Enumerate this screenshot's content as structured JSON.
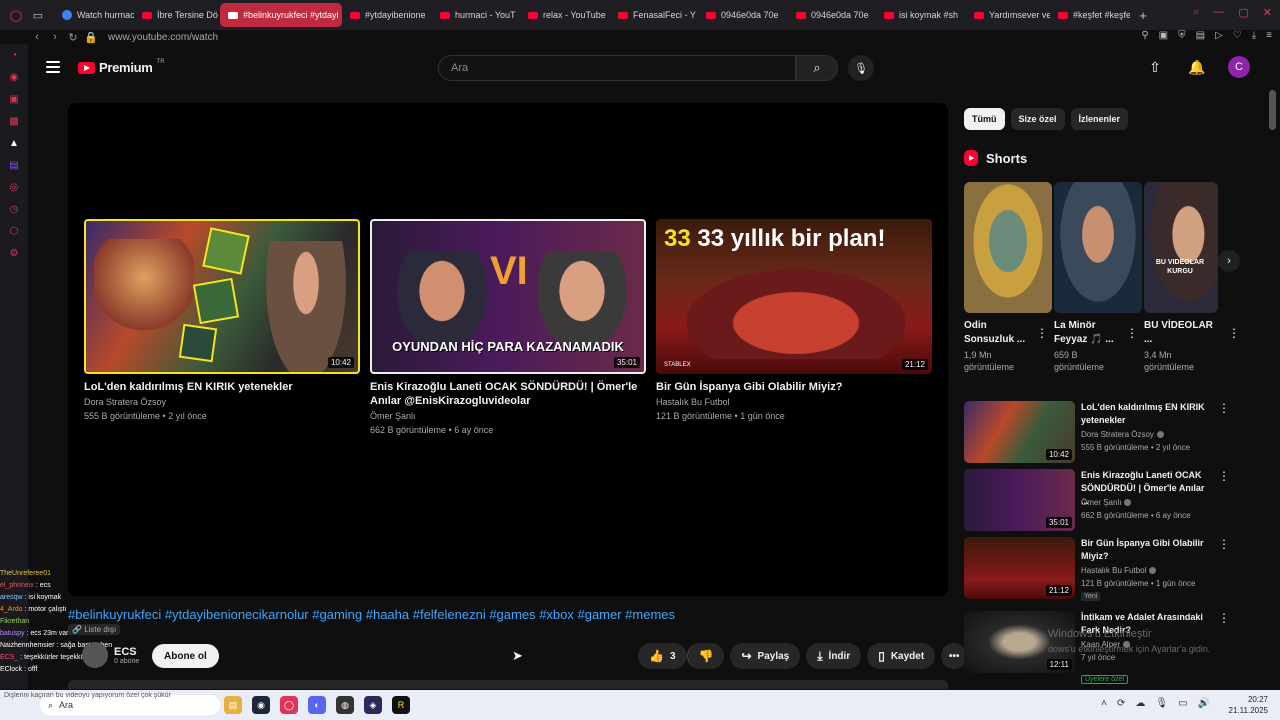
{
  "browser": {
    "tabs": [
      {
        "label": "",
        "active": false,
        "icon": "grid-icon"
      },
      {
        "label": "Watch hurmac",
        "active": false,
        "icon": "globe-icon"
      },
      {
        "label": "İbre Tersine Dö",
        "active": false,
        "icon": "youtube-icon"
      },
      {
        "label": "#belinkuyrukfeci #ytdayi",
        "active": true,
        "icon": "youtube-icon"
      },
      {
        "label": "#ytdayibenione",
        "active": false,
        "icon": "youtube-icon"
      },
      {
        "label": "hurmaci - YouT",
        "active": false,
        "icon": "youtube-icon"
      },
      {
        "label": "relax - YouTube",
        "active": false,
        "icon": "youtube-icon"
      },
      {
        "label": "FenasalFeci - Y",
        "active": false,
        "icon": "youtube-icon"
      },
      {
        "label": "0946e0da 70e",
        "active": false,
        "icon": "youtube-icon"
      },
      {
        "label": "0946e0da 70e",
        "active": false,
        "icon": "youtube-icon"
      },
      {
        "label": "isi koymak #sh",
        "active": false,
        "icon": "youtube-icon"
      },
      {
        "label": "Yardımsever ve",
        "active": false,
        "icon": "youtube-icon"
      },
      {
        "label": "#keşfet #keşfet",
        "active": false,
        "icon": "youtube-icon"
      }
    ],
    "url": "www.youtube.com/watch"
  },
  "header": {
    "logo_text": "Premium",
    "logo_region": "TR",
    "search_placeholder": "Ara",
    "avatar_letter": "C"
  },
  "endcards": [
    {
      "title": "LoL'den kaldırılmış EN KIRIK yetenekler",
      "channel": "Dora Stratera Özsoy",
      "meta": "555 B görüntüleme • 2 yıl önce",
      "duration": "10:42"
    },
    {
      "title": "Enis Kirazoğlu Laneti OCAK SÖNDÜRDÜ! | Ömer'le Anılar @EnisKirazogluvideolar",
      "channel": "Ömer Şanlı",
      "meta": "662 B görüntüleme • 6 ay önce",
      "duration": "35:01",
      "thumb_text": "OYUNDAN HİÇ PARA KAZANAMADIK"
    },
    {
      "title": "Bir Gün İspanya Gibi Olabilir Miyiz?",
      "channel": "Hastalık Bu Futbol",
      "meta": "121 B görüntüleme • 1 gün önce",
      "duration": "21:12",
      "thumb_text": "33 yıllık bir plan!",
      "thumb_badge": "STABLEX"
    }
  ],
  "video": {
    "hashtags": "#belinkuyrukfeci #ytdayibenionecikarnolur #gaming #haaha #felfelenezni #games #xbox #gamer #memes",
    "visibility": "Liste dışı",
    "channel_name": "ECS",
    "channel_subs": "0 abone",
    "subscribe_label": "Abone ol",
    "likes": "3",
    "share_label": "Paylaş",
    "download_label": "İndir",
    "save_label": "Kaydet"
  },
  "chat": [
    {
      "user": "TheUnreferee01",
      "msg": "",
      "color": "#e0c040"
    },
    {
      "user": "el_phoneix",
      "msg": "ecs",
      "color": "#e05a5a"
    },
    {
      "user": "aresqw",
      "msg": "isi koymak",
      "color": "#7ec8ff"
    },
    {
      "user": "4_Ardo",
      "msg": "motor çalıştı",
      "color": "#ff8a3c"
    },
    {
      "user": "Fikrethan",
      "msg": "",
      "color": "#9ad05a"
    },
    {
      "user": "batuspy",
      "msg": "ecs 23m var",
      "color": "#c08aff"
    },
    {
      "user": "Naizhennhemsier",
      "msg": "sağa baştım ben",
      "color": "#ffffff"
    },
    {
      "user": "ECS_",
      "msg": "teşekkürler teşekkürler",
      "color": "#ff4f7a"
    },
    {
      "user": "EClock",
      "msg": "offf",
      "color": "#ffffff"
    }
  ],
  "sidebar": {
    "chips": [
      "Tümü",
      "Size özel",
      "İzlenenler"
    ],
    "shorts_title": "Shorts",
    "shorts": [
      {
        "title": "Odin Sonsuzluk ...",
        "views": "1,9 Mn görüntüleme"
      },
      {
        "title": "La Minör Feyyaz 🎵 ...",
        "views": "659 B görüntüleme"
      },
      {
        "title": "BU VİDEOLAR ...",
        "views": "3,4 Mn görüntüleme",
        "thumb_text": "BU VIDEOLAR KURGU"
      }
    ],
    "recs": [
      {
        "title": "LoL'den kaldırılmış EN KIRIK yetenekler",
        "channel": "Dora Stratera Özsoy",
        "meta": "555 B görüntüleme • 2 yıl önce",
        "duration": "10:42"
      },
      {
        "title": "Enis Kirazoğlu Laneti OCAK SÖNDÜRDÜ! | Ömer'le Anılar ...",
        "channel": "Ömer Şanlı",
        "meta": "662 B görüntüleme • 6 ay önce",
        "duration": "35:01"
      },
      {
        "title": "Bir Gün İspanya Gibi Olabilir Miyiz?",
        "channel": "Hastalık Bu Futbol",
        "meta": "121 B görüntüleme • 1 gün önce",
        "duration": "21:12",
        "badge": "Yeni"
      },
      {
        "title": "İntikam ve Adalet Arasındaki Fark Nedir?",
        "channel": "Kaan Alper",
        "meta": "7 yıl önce",
        "duration": "12:11",
        "badge": "Üyelere özel"
      }
    ]
  },
  "windows_notice": {
    "line1": "Windows'u Etkinleştir",
    "line2": "dows'u etkinleştirmek için Ayarlar'a gidin."
  },
  "taskbar": {
    "search": "Ara",
    "time": "20:27",
    "date": "21.11.2025",
    "caption": "Dişlerini kaçıran bu videoyu yapıyorum özel çok şükür"
  }
}
